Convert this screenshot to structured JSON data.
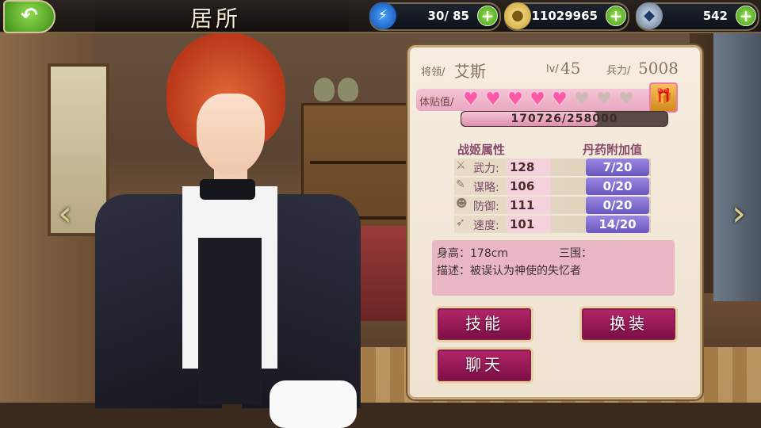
{
  "header": {
    "back_icon": "curved-arrow-back",
    "title": "居所",
    "energy": {
      "value": "30/ 85",
      "icon": "lightning-icon"
    },
    "gold": {
      "value": "11029965",
      "icon": "coin-icon"
    },
    "gems": {
      "value": "542",
      "icon": "crystal-icon"
    },
    "plus_label": "+"
  },
  "character": {
    "general_label": "将领/",
    "name": "艾斯",
    "level_label": "lv/",
    "level": "45",
    "troops_label": "兵力/",
    "troops": "5008",
    "affection_label": "体贴值/",
    "hearts_filled": 5,
    "hearts_total": 8,
    "affection_value": "170726/258000",
    "affection_fraction": 0.6617
  },
  "stats": {
    "header_attr": "战姬属性",
    "header_bonus": "丹药附加值",
    "rows": [
      {
        "icon": "sword-icon",
        "label": "武力:",
        "value": "128",
        "bonus": "7/20"
      },
      {
        "icon": "scroll-icon",
        "label": "谋略:",
        "value": "106",
        "bonus": "0/20"
      },
      {
        "icon": "shield-mask-icon",
        "label": "防御:",
        "value": "111",
        "bonus": "0/20"
      },
      {
        "icon": "boot-icon",
        "label": "速度:",
        "value": "101",
        "bonus": "14/20"
      }
    ]
  },
  "profile": {
    "height": "身高：178cm",
    "measure": "三围：",
    "description": "描述：被误认为神使的失忆者"
  },
  "buttons": {
    "skills": "技能",
    "outfit": "换装",
    "chat": "聊天"
  },
  "nav": {
    "left_arrow": "‹",
    "right_arrow": "›"
  }
}
